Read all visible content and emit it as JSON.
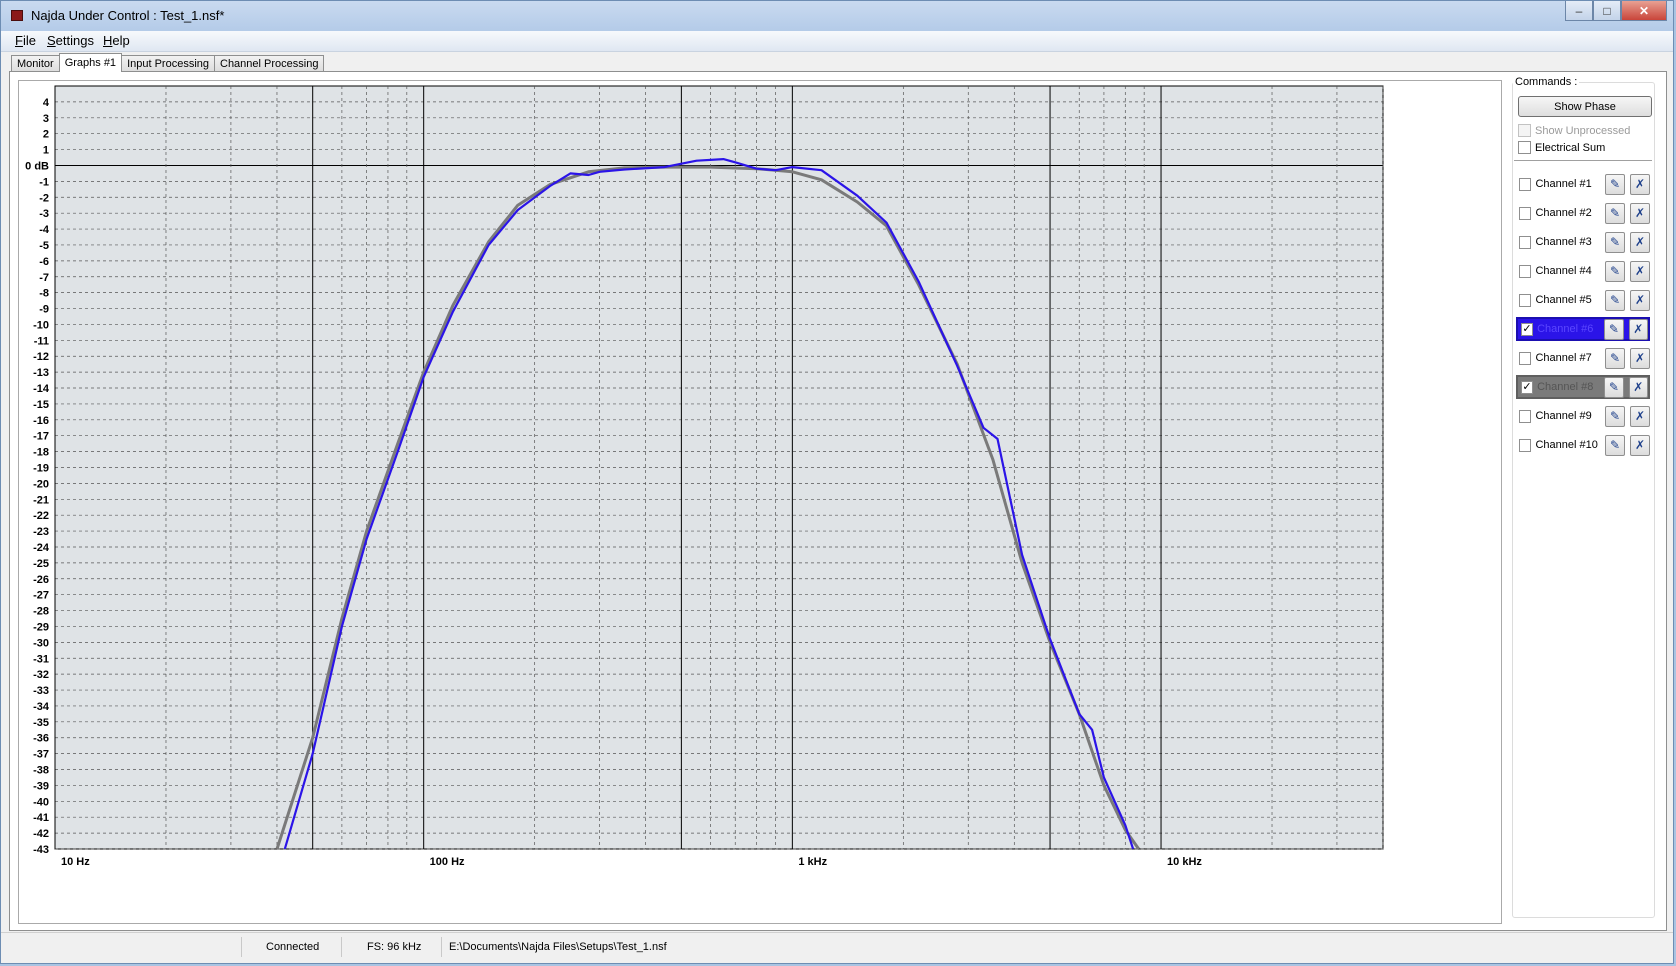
{
  "window": {
    "title": "Najda Under Control : Test_1.nsf*"
  },
  "menu": {
    "items": [
      {
        "label": "File",
        "accel": "F",
        "rest": "ile"
      },
      {
        "label": "Settings",
        "accel": "S",
        "rest": "ettings"
      },
      {
        "label": "Help",
        "accel": "H",
        "rest": "elp"
      }
    ]
  },
  "tabs": [
    "Monitor",
    "Graphs #1",
    "Input Processing",
    "Channel Processing"
  ],
  "active_tab": "Graphs #1",
  "commands": {
    "label": "Commands :",
    "show_phase": "Show Phase",
    "show_unprocessed": "Show Unprocessed",
    "electrical_sum": "Electrical Sum"
  },
  "channels": [
    {
      "label": "Channel #1",
      "checked": false,
      "state": "normal"
    },
    {
      "label": "Channel #2",
      "checked": false,
      "state": "normal"
    },
    {
      "label": "Channel #3",
      "checked": false,
      "state": "normal"
    },
    {
      "label": "Channel #4",
      "checked": false,
      "state": "normal"
    },
    {
      "label": "Channel #5",
      "checked": false,
      "state": "normal"
    },
    {
      "label": "Channel #6",
      "checked": true,
      "state": "blue"
    },
    {
      "label": "Channel #7",
      "checked": false,
      "state": "normal"
    },
    {
      "label": "Channel #8",
      "checked": true,
      "state": "gray"
    },
    {
      "label": "Channel #9",
      "checked": false,
      "state": "normal"
    },
    {
      "label": "Channel #10",
      "checked": false,
      "state": "normal"
    }
  ],
  "status": {
    "connection": "Connected",
    "fs": "FS: 96 kHz",
    "path": "E:\\Documents\\Najda Files\\Setups\\Test_1.nsf"
  },
  "colors": {
    "channel6": "#2b14e8",
    "channel8": "#7a7a7a",
    "plot_bg": "#dfe3e6"
  },
  "chart_data": {
    "type": "line",
    "x_scale": "log",
    "xlim": [
      10,
      40000
    ],
    "ylim": [
      -43,
      5
    ],
    "x_tick_labels": [
      {
        "value": 10,
        "label": "10 Hz"
      },
      {
        "value": 100,
        "label": "100 Hz"
      },
      {
        "value": 1000,
        "label": "1 kHz"
      },
      {
        "value": 10000,
        "label": "10 kHz"
      }
    ],
    "y_ticks": [
      4,
      3,
      2,
      1,
      0,
      -1,
      -2,
      -3,
      -4,
      -5,
      -6,
      -7,
      -8,
      -9,
      -10,
      -11,
      -12,
      -13,
      -14,
      -15,
      -16,
      -17,
      -18,
      -19,
      -20,
      -21,
      -22,
      -23,
      -24,
      -25,
      -26,
      -27,
      -28,
      -29,
      -30,
      -31,
      -32,
      -33,
      -34,
      -35,
      -36,
      -37,
      -38,
      -39,
      -40,
      -41,
      -42,
      -43
    ],
    "y_zero_label": "0 dB",
    "grid": true,
    "series": [
      {
        "channel": "Channel #8",
        "color": "#7a7a7a",
        "x": [
          40,
          50,
          60,
          70,
          85,
          100,
          120,
          150,
          180,
          220,
          280,
          350,
          450,
          600,
          800,
          1000,
          1200,
          1500,
          1800,
          2200,
          2800,
          3500,
          4200,
          5000,
          6000,
          7000,
          8000,
          8700
        ],
        "y": [
          -43,
          -36,
          -28.5,
          -23,
          -17.5,
          -13,
          -8.8,
          -4.8,
          -2.5,
          -1.2,
          -0.4,
          -0.15,
          -0.1,
          -0.1,
          -0.2,
          -0.4,
          -0.9,
          -2.3,
          -3.8,
          -7.5,
          -12.5,
          -18.5,
          -25,
          -30,
          -34.5,
          -39,
          -41.8,
          -43
        ]
      },
      {
        "channel": "Channel #6",
        "color": "#2b14e8",
        "x": [
          42,
          50,
          60,
          70,
          85,
          100,
          120,
          150,
          180,
          220,
          250,
          280,
          300,
          350,
          450,
          550,
          650,
          700,
          800,
          900,
          1000,
          1200,
          1500,
          1800,
          2200,
          2800,
          3300,
          3600,
          4200,
          5000,
          6000,
          6500,
          7000,
          8000,
          8400
        ],
        "y": [
          -43,
          -37,
          -29,
          -23.5,
          -18,
          -13.3,
          -9.2,
          -5,
          -2.8,
          -1.3,
          -0.5,
          -0.6,
          -0.4,
          -0.25,
          -0.1,
          0.3,
          0.4,
          0.2,
          -0.2,
          -0.3,
          -0.1,
          -0.3,
          -1.9,
          -3.6,
          -7.3,
          -12.6,
          -16.5,
          -17.2,
          -24.5,
          -29.8,
          -34.5,
          -35.5,
          -38.5,
          -41.5,
          -43
        ]
      }
    ]
  }
}
